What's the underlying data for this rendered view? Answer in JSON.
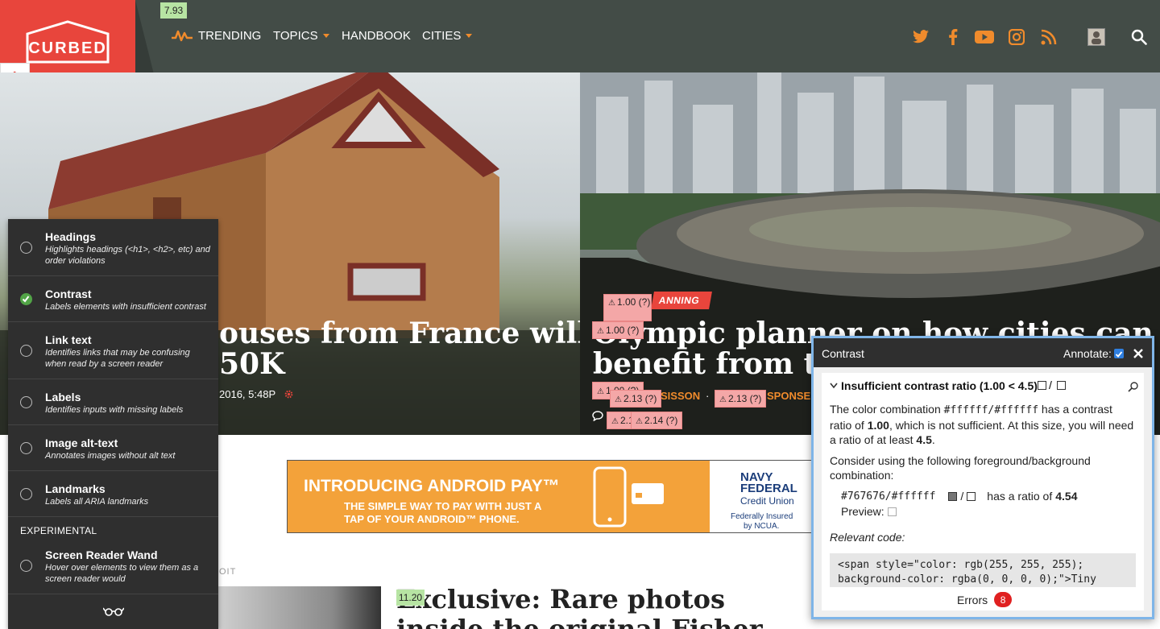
{
  "header": {
    "logo_text": "CURBED",
    "score_badge": "7.93",
    "nav": [
      {
        "label": "TRENDING",
        "icon": "trending-icon"
      },
      {
        "label": "TOPICS",
        "has_dropdown": true
      },
      {
        "label": "HANDBOOK"
      },
      {
        "label": "CITIES",
        "has_dropdown": true
      }
    ],
    "social_icons": [
      "twitter-icon",
      "facebook-icon",
      "youtube-icon",
      "instagram-icon",
      "rss-icon",
      "user-avatar-icon",
      "search-icon"
    ]
  },
  "hero_left": {
    "title_line1": "ouses from France will",
    "title_line2": "50K",
    "timestamp": "2016, 5:48P"
  },
  "hero_right": {
    "category": "ANNING",
    "title_line1": "Olympic planner on how cities can",
    "title_line2": "benefit from the",
    "author_fragment": "SISSON",
    "author_sep": "·",
    "sponsor_fragment": "SPONSE"
  },
  "error_badges": [
    "1.00 (?)",
    "1.00 (?)",
    "1.00 (?)",
    "2.13 (?)",
    "2.13 (?)",
    "2.1",
    "2.14 (?)"
  ],
  "ad": {
    "title": "INTRODUCING ANDROID PAY™",
    "sub1": "THE SIMPLE WAY TO PAY WITH JUST A",
    "sub2": "TAP OF YOUR ANDROID™ PHONE.",
    "brand1": "NAVY",
    "brand2": "FEDERAL",
    "brand3": "Credit Union",
    "fine1": "Federally Insured",
    "fine2": "by NCUA."
  },
  "article": {
    "kicker": "OIT",
    "score_badge": "11.20",
    "title_line1": "Exclusive: Rare photos",
    "title_line2": "inside the original Fisher"
  },
  "panel": {
    "options": [
      {
        "title": "Headings",
        "desc": "Highlights headings (<h1>, <h2>, etc) and order violations",
        "checked": false
      },
      {
        "title": "Contrast",
        "desc": "Labels elements with insufficient contrast",
        "checked": true
      },
      {
        "title": "Link text",
        "desc": "Identifies links that may be confusing when read by a screen reader",
        "checked": false
      },
      {
        "title": "Labels",
        "desc": "Identifies inputs with missing labels",
        "checked": false
      },
      {
        "title": "Image alt-text",
        "desc": "Annotates images without alt text",
        "checked": false
      },
      {
        "title": "Landmarks",
        "desc": "Labels all ARIA landmarks",
        "checked": false
      }
    ],
    "experimental_label": "EXPERIMENTAL",
    "experimental": {
      "title": "Screen Reader Wand",
      "desc": "Hover over elements to view them as a screen reader would",
      "checked": false
    }
  },
  "dialog": {
    "title": "Contrast",
    "annotate_label": "Annotate:",
    "annotate_checked": true,
    "section_title": "Insufficient contrast ratio (1.00 < 4.5)",
    "p1_pre": "The color combination ",
    "p1_code": "#ffffff/#ffffff",
    "p1_mid": " has a contrast ratio of ",
    "p1_ratio": "1.00",
    "p1_post": ", which is not sufficient. At this size, you will need a ratio of at least ",
    "p1_req": "4.5",
    "p1_end": ".",
    "p2": "Consider using the following foreground/background combination:",
    "suggest_code": "#767676/#ffffff",
    "suggest_mid": "has a ratio of",
    "suggest_ratio": "4.54",
    "preview_label": "Preview:",
    "relevant_label": "Relevant code:",
    "code_line1": "<span style=\"color: rgb(255, 255, 255);",
    "code_line2": "background-color: rgba(0, 0, 0, 0);\">Tiny",
    "errors_label": "Errors",
    "errors_count": "8"
  },
  "colors": {
    "header_bg": "#434c47",
    "brand_red": "#e8453c",
    "accent_orange": "#f08b2c",
    "panel_bg": "#2f2f2f",
    "error_badge": "#f4a7a7",
    "score_badge": "#b7e4a3"
  }
}
